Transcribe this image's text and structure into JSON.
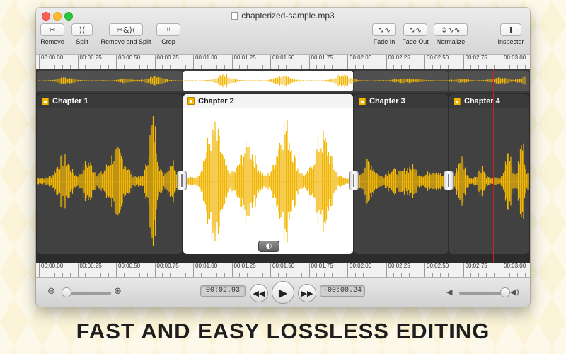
{
  "window": {
    "title": "chapterized-sample.mp3"
  },
  "toolbar": {
    "items": [
      {
        "label": "Remove",
        "icon": "scissors-icon",
        "glyph": "✂"
      },
      {
        "label": "Split",
        "icon": "split-icon",
        "glyph": "⟩⟨"
      },
      {
        "label": "Remove and Split",
        "icon": "remove-split-icon",
        "glyph": "✂&⟩⟨"
      },
      {
        "label": "Crop",
        "icon": "crop-icon",
        "glyph": "⌗"
      },
      {
        "label": "Fade In",
        "icon": "fade-in-icon",
        "glyph": "∿∿"
      },
      {
        "label": "Fade Out",
        "icon": "fade-out-icon",
        "glyph": "∿∿"
      },
      {
        "label": "Normalize",
        "icon": "normalize-icon",
        "glyph": "↕∿∿"
      },
      {
        "label": "Inspector",
        "icon": "info-icon",
        "glyph": "i"
      }
    ]
  },
  "ruler": {
    "labels": [
      "00:00.00",
      "00:00.25",
      "00:00.50",
      "00:00.75",
      "00:01.00",
      "00:01.25",
      "00:01.50",
      "00:01.75",
      "00:02.00",
      "00:02.25",
      "00:02.50",
      "00:02.75",
      "00:03.00"
    ]
  },
  "chapters": [
    {
      "title": "Chapter 1",
      "active": false
    },
    {
      "title": "Chapter 2",
      "active": true
    },
    {
      "title": "Chapter 3",
      "active": false
    },
    {
      "title": "Chapter 4",
      "active": false
    }
  ],
  "transport": {
    "current_time": "00:02.93",
    "remaining_time": "-00:00.24",
    "zoom_level": 0.05,
    "volume_level": 0.93
  },
  "colors": {
    "waveform": "#f2b705",
    "playhead": "#d81b1b"
  },
  "tagline": "FAST AND EASY LOSSLESS EDITING"
}
